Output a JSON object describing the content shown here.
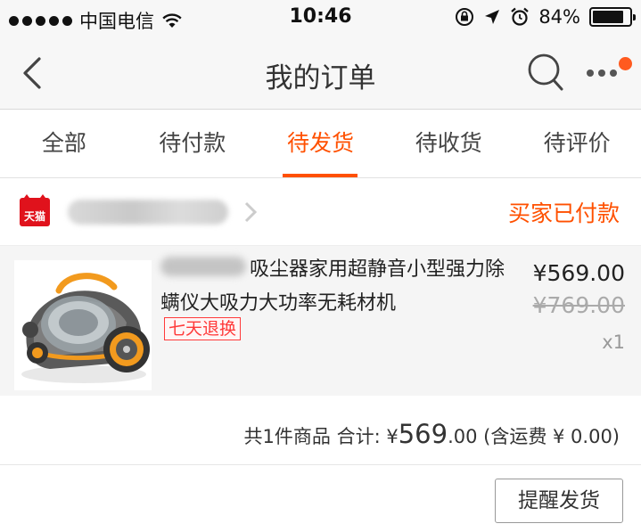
{
  "status_bar": {
    "carrier": "中国电信",
    "time": "10:46",
    "battery_percent": "84%",
    "battery_level": 0.84
  },
  "nav": {
    "title": "我的订单",
    "icons": [
      "back-chevron-icon",
      "search-icon",
      "more-icon"
    ],
    "has_notification_dot": true,
    "accent_color": "#ff5000"
  },
  "tabs": [
    {
      "label": "全部",
      "active": false
    },
    {
      "label": "待付款",
      "active": false
    },
    {
      "label": "待发货",
      "active": true
    },
    {
      "label": "待收货",
      "active": false
    },
    {
      "label": "待评价",
      "active": false
    }
  ],
  "order": {
    "shop_logo_text": "天猫",
    "status": "买家已付款",
    "product": {
      "title_line1": "吸尘器家用超静音小型强力除",
      "title_line2": "螨仪大吸力大功率无耗材机",
      "badge": "七天退换",
      "price": "¥569.00",
      "original_price": "¥769.00",
      "quantity": "x1"
    },
    "summary": {
      "prefix": "共1件商品 合计: ¥",
      "amount_big": "569",
      "amount_small": ".00",
      "shipping": " (含运费 ¥ 0.00)"
    },
    "action_button": "提醒发货"
  }
}
